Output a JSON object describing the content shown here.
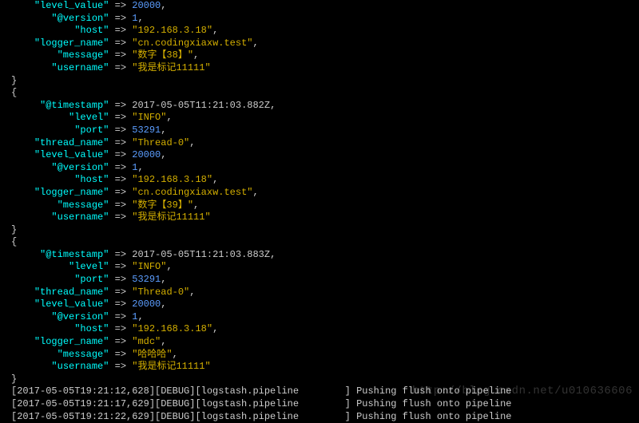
{
  "block0": {
    "level_value_key": "\"level_value\"",
    "level_value_val": "20000",
    "version_key": "\"@version\"",
    "version_val": "1",
    "host_key": "\"host\"",
    "host_val": "\"192.168.3.18\"",
    "logger_name_key": "\"logger_name\"",
    "logger_name_val": "\"cn.codingxiaxw.test\"",
    "message_key": "\"message\"",
    "message_val": "\"数字【38】\"",
    "username_key": "\"username\"",
    "username_val": "\"我是标记11111\""
  },
  "block1": {
    "timestamp_key": "\"@timestamp\"",
    "timestamp_val": "2017-05-05T11:21:03.882Z",
    "level_key": "\"level\"",
    "level_val": "\"INFO\"",
    "port_key": "\"port\"",
    "port_val": "53291",
    "thread_name_key": "\"thread_name\"",
    "thread_name_val": "\"Thread-0\"",
    "level_value_key": "\"level_value\"",
    "level_value_val": "20000",
    "version_key": "\"@version\"",
    "version_val": "1",
    "host_key": "\"host\"",
    "host_val": "\"192.168.3.18\"",
    "logger_name_key": "\"logger_name\"",
    "logger_name_val": "\"cn.codingxiaxw.test\"",
    "message_key": "\"message\"",
    "message_val": "\"数字【39】\"",
    "username_key": "\"username\"",
    "username_val": "\"我是标记11111\""
  },
  "block2": {
    "timestamp_key": "\"@timestamp\"",
    "timestamp_val": "2017-05-05T11:21:03.883Z",
    "level_key": "\"level\"",
    "level_val": "\"INFO\"",
    "port_key": "\"port\"",
    "port_val": "53291",
    "thread_name_key": "\"thread_name\"",
    "thread_name_val": "\"Thread-0\"",
    "level_value_key": "\"level_value\"",
    "level_value_val": "20000",
    "version_key": "\"@version\"",
    "version_val": "1",
    "host_key": "\"host\"",
    "host_val": "\"192.168.3.18\"",
    "logger_name_key": "\"logger_name\"",
    "logger_name_val": "\"mdc\"",
    "message_key": "\"message\"",
    "message_val": "\"哈哈哈\"",
    "username_key": "\"username\"",
    "username_val": "\"我是标记11111\""
  },
  "loglines": {
    "l1": "[2017-05-05T19:21:12,628][DEBUG][logstash.pipeline        ] Pushing flush onto pipeline",
    "l2": "[2017-05-05T19:21:17,629][DEBUG][logstash.pipeline        ] Pushing flush onto pipeline",
    "l3": "[2017-05-05T19:21:22,629][DEBUG][logstash.pipeline        ] Pushing flush onto pipeline"
  },
  "sym": {
    "arrow": " => ",
    "comma": ",",
    "open": "{",
    "close": "}"
  },
  "watermark": "http://blog.csdn.net/u010636606"
}
